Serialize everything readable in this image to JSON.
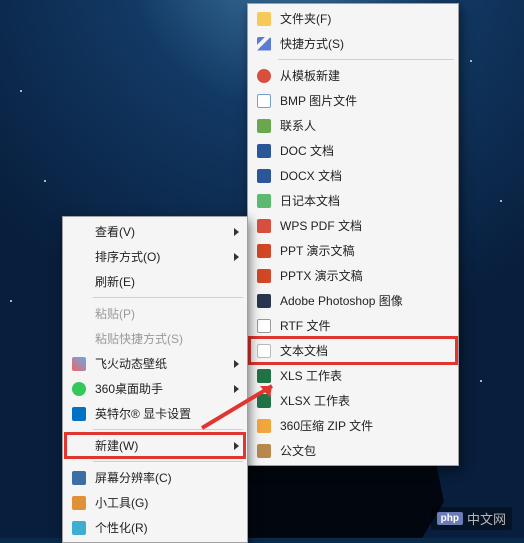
{
  "watermark": {
    "badge": "php",
    "text": "中文网"
  },
  "leftMenu": {
    "items": [
      {
        "id": "view",
        "label": "查看(V)",
        "hasSubmenu": true,
        "icon": null
      },
      {
        "id": "sort",
        "label": "排序方式(O)",
        "hasSubmenu": true,
        "icon": null
      },
      {
        "id": "refresh",
        "label": "刷新(E)",
        "icon": null
      },
      {
        "sep": true
      },
      {
        "id": "paste",
        "label": "粘贴(P)",
        "disabled": true,
        "icon": null
      },
      {
        "id": "paste-shortcut",
        "label": "粘贴快捷方式(S)",
        "disabled": true,
        "icon": null
      },
      {
        "id": "wallpaper",
        "label": "飞火动态壁纸",
        "hasSubmenu": true,
        "icon": "ic-wallpaper"
      },
      {
        "id": "desk360",
        "label": "360桌面助手",
        "hasSubmenu": true,
        "icon": "ic-360"
      },
      {
        "id": "intel",
        "label": "英特尔® 显卡设置",
        "icon": "ic-intel"
      },
      {
        "sep": true
      },
      {
        "id": "new",
        "label": "新建(W)",
        "hasSubmenu": true,
        "highlight": true,
        "icon": null
      },
      {
        "sep": true
      },
      {
        "id": "resolution",
        "label": "屏幕分辨率(C)",
        "icon": "ic-monitor"
      },
      {
        "id": "gadgets",
        "label": "小工具(G)",
        "icon": "ic-gadget"
      },
      {
        "id": "personalize",
        "label": "个性化(R)",
        "icon": "ic-personalize"
      }
    ]
  },
  "rightMenu": {
    "items": [
      {
        "id": "folder",
        "label": "文件夹(F)",
        "icon": "ic-folder"
      },
      {
        "id": "shortcut",
        "label": "快捷方式(S)",
        "icon": "ic-shortcut"
      },
      {
        "sep": true
      },
      {
        "id": "template",
        "label": "从模板新建",
        "icon": "ic-template"
      },
      {
        "id": "bmp",
        "label": "BMP 图片文件",
        "icon": "ic-bmp"
      },
      {
        "id": "contact",
        "label": "联系人",
        "icon": "ic-contact"
      },
      {
        "id": "doc",
        "label": "DOC 文档",
        "icon": "ic-doc"
      },
      {
        "id": "docx",
        "label": "DOCX 文档",
        "icon": "ic-docx"
      },
      {
        "id": "diary",
        "label": "日记本文档",
        "icon": "ic-diary"
      },
      {
        "id": "pdf",
        "label": "WPS PDF 文档",
        "icon": "ic-pdf"
      },
      {
        "id": "ppt",
        "label": "PPT 演示文稿",
        "icon": "ic-ppt"
      },
      {
        "id": "pptx",
        "label": "PPTX 演示文稿",
        "icon": "ic-pptx"
      },
      {
        "id": "psd",
        "label": "Adobe Photoshop 图像",
        "icon": "ic-ps"
      },
      {
        "id": "rtf",
        "label": "RTF 文件",
        "icon": "ic-rtf"
      },
      {
        "id": "txt",
        "label": "文本文档",
        "icon": "ic-txt",
        "highlight": true
      },
      {
        "id": "xls",
        "label": "XLS 工作表",
        "icon": "ic-xls"
      },
      {
        "id": "xlsx",
        "label": "XLSX 工作表",
        "icon": "ic-xlsx"
      },
      {
        "id": "zip",
        "label": "360压缩 ZIP 文件",
        "icon": "ic-zip"
      },
      {
        "id": "briefcase",
        "label": "公文包",
        "icon": "ic-briefcase"
      }
    ]
  }
}
